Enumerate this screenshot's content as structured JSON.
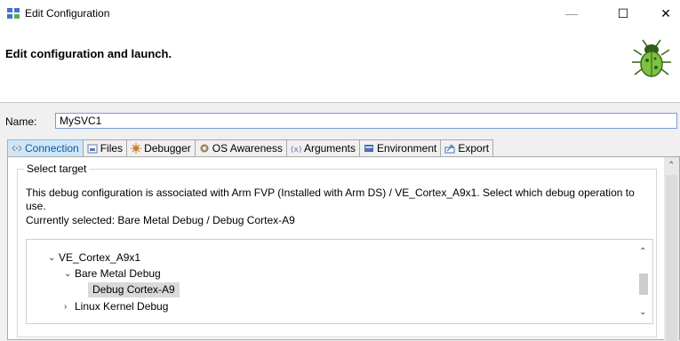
{
  "window": {
    "title": "Edit Configuration",
    "min_glyph": "—",
    "max_glyph": "☐",
    "close_glyph": "✕"
  },
  "header": {
    "title": "Edit configuration and launch.",
    "icon": "bug-icon"
  },
  "name_field": {
    "label": "Name:",
    "value": "MySVC1"
  },
  "tabs": [
    {
      "label": "Connection",
      "icon": "connection-icon",
      "active": true
    },
    {
      "label": "Files",
      "icon": "files-icon",
      "active": false
    },
    {
      "label": "Debugger",
      "icon": "debugger-icon",
      "active": false
    },
    {
      "label": "OS Awareness",
      "icon": "os-awareness-icon",
      "active": false
    },
    {
      "label": "Arguments",
      "icon": "arguments-icon",
      "active": false
    },
    {
      "label": "Environment",
      "icon": "environment-icon",
      "active": false
    },
    {
      "label": "Export",
      "icon": "export-icon",
      "active": false
    }
  ],
  "connection": {
    "group_label": "Select target",
    "description": "This debug configuration is associated with Arm FVP (Installed with Arm DS) / VE_Cortex_A9x1. Select which debug operation to use.",
    "current": "Currently selected: Bare Metal Debug / Debug Cortex-A9",
    "tree": [
      {
        "label": "VE_Cortex_A9x1",
        "state": "expanded",
        "level": 0
      },
      {
        "label": "Bare Metal Debug",
        "state": "expanded",
        "level": 1
      },
      {
        "label": "Debug Cortex-A9",
        "state": "leaf",
        "level": 2,
        "selected": true
      },
      {
        "label": "Linux Kernel Debug",
        "state": "collapsed",
        "level": 1
      }
    ]
  },
  "colors": {
    "active_tab_bg": "#cfe6f7",
    "active_tab_text": "#0b5aa6",
    "selection_bg": "#d9d9d9"
  }
}
